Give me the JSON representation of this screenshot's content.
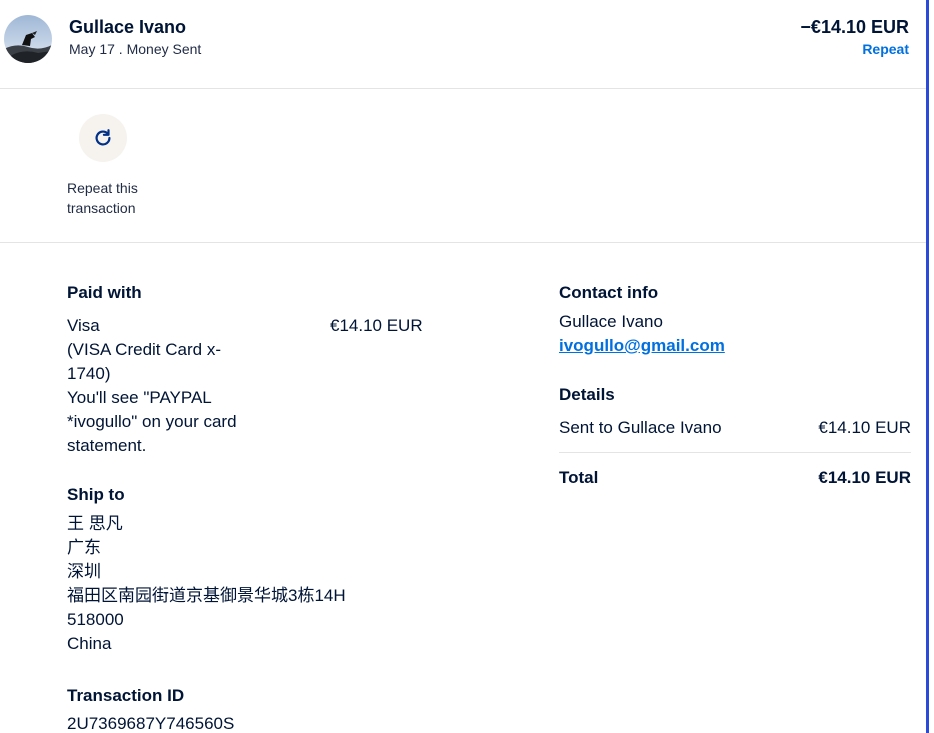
{
  "header": {
    "name": "Gullace Ivano",
    "subline": "May 17 . Money Sent",
    "amount": "−€14.10 EUR",
    "repeat_link": "Repeat"
  },
  "repeat_action": {
    "icon": "refresh-icon",
    "label": "Repeat this transaction"
  },
  "paid_with": {
    "title": "Paid with",
    "lines": [
      "Visa",
      "(VISA Credit Card x-",
      "1740)",
      "You'll see \"PAYPAL",
      "*ivogullo\" on your card",
      "statement."
    ],
    "amount": "€14.10 EUR"
  },
  "ship_to": {
    "title": "Ship to",
    "lines": [
      "王 思凡",
      "广东",
      "深圳",
      "福田区南园街道京基御景华城3栋14H",
      "518000",
      "China"
    ]
  },
  "transaction": {
    "title": "Transaction ID",
    "id": "2U7369687Y746560S"
  },
  "contact": {
    "title": "Contact info",
    "name": "Gullace Ivano",
    "email": "ivogullo@gmail.com"
  },
  "details": {
    "title": "Details",
    "row_label": "Sent to Gullace Ivano",
    "row_value": "€14.10 EUR",
    "total_label": "Total",
    "total_value": "€14.10 EUR"
  },
  "colors": {
    "link": "#0070e0",
    "text": "#001435",
    "edge": "#2a4ad7"
  }
}
